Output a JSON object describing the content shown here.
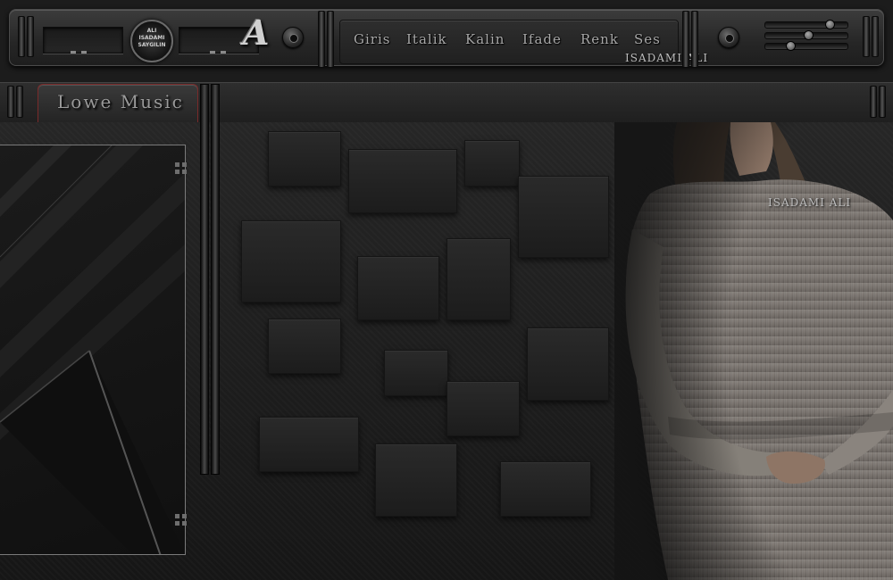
{
  "app": {
    "brand_badge": "ALI\nISADAMI\nSAYGILIN",
    "logo_letter": "A",
    "watermark": "ISADAMI ALI"
  },
  "player": {
    "display_left": "- -",
    "display_right": "- -"
  },
  "menu": {
    "items": [
      "Giris",
      "Italik",
      "Kalin",
      "Ifade",
      "Renk",
      "Ses"
    ]
  },
  "tab": {
    "title": "Lowe Music"
  },
  "photo": {
    "watermark": "ISADAMI ALI"
  },
  "icons": {
    "left_disc": "disc-icon",
    "right_disc": "disc-icon",
    "logo": "letter-a-logo-icon",
    "volume": "slider-icon"
  },
  "colors": {
    "background": "#1c1c1c",
    "accent_border": "#7a2a2a",
    "text": "#a8a8a8"
  }
}
